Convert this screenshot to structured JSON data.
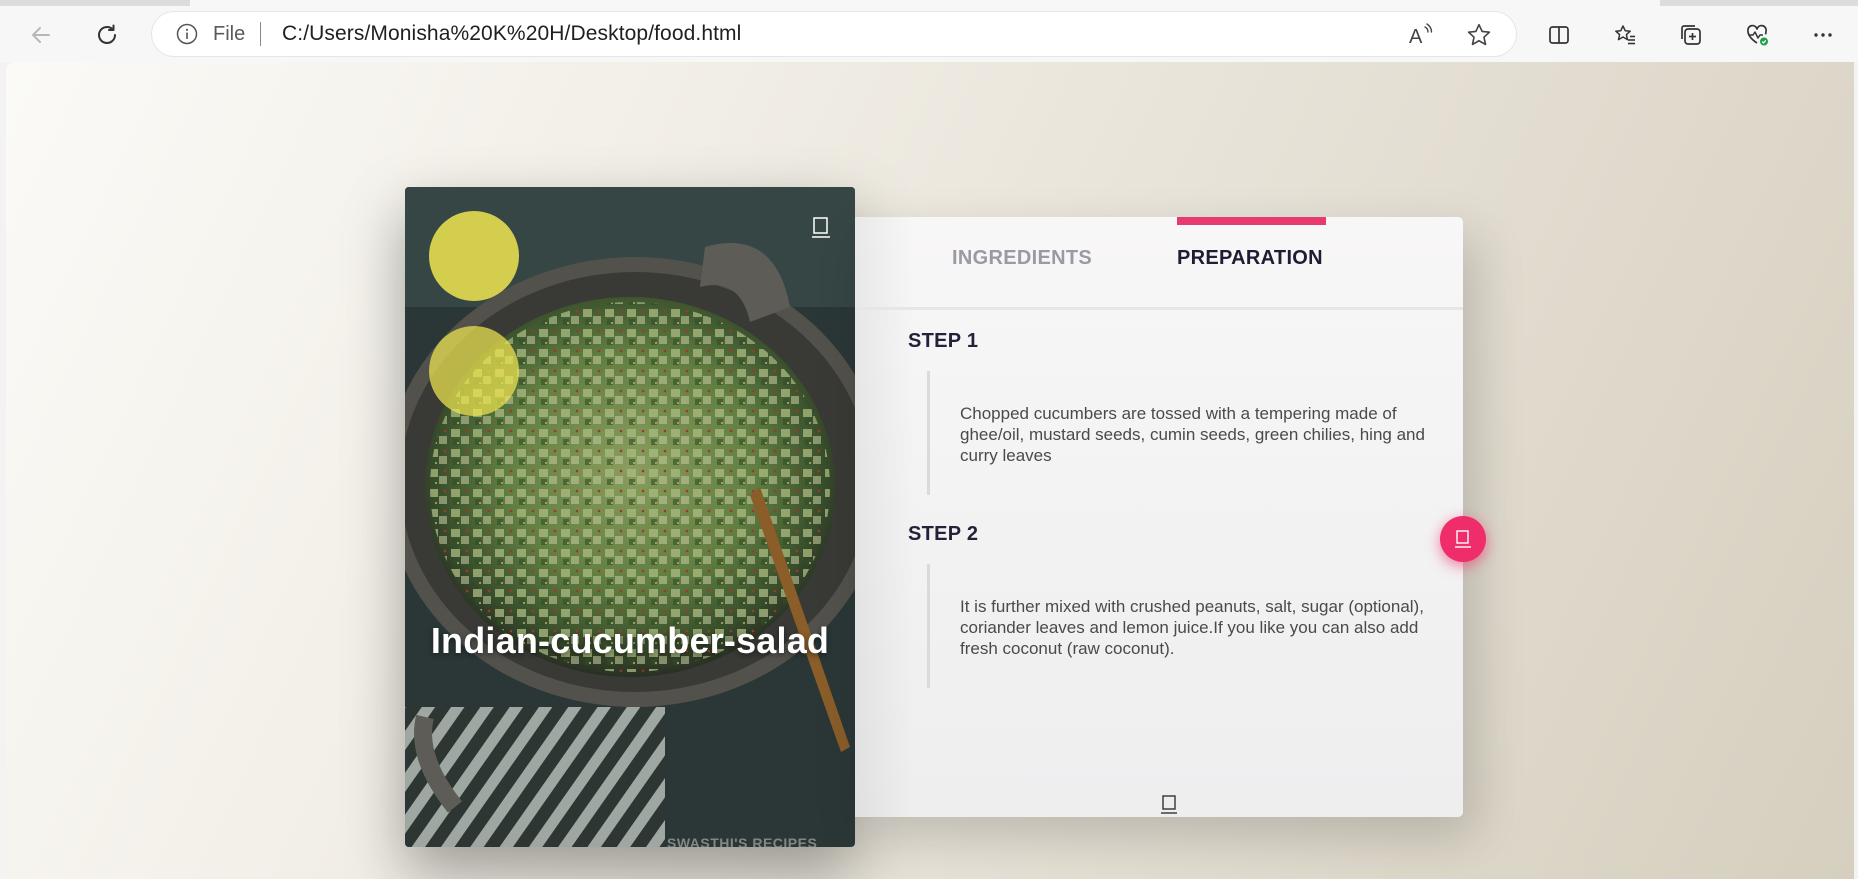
{
  "browser": {
    "address": {
      "scheme_label": "File",
      "url": "C:/Users/Monisha%20K%20H/Desktop/food.html"
    }
  },
  "recipe": {
    "title": "Indian-cucumber-salad",
    "watermark": "SWASTHI'S RECIPES",
    "tabs": [
      {
        "label": "INGREDIENTS",
        "active": false
      },
      {
        "label": "PREPARATION",
        "active": true
      }
    ],
    "steps": [
      {
        "title": "STEP 1",
        "text": "Chopped cucumbers are tossed with a tempering made of ghee/oil, mustard seeds, cumin seeds, green chilies, hing and curry leaves"
      },
      {
        "title": "STEP 2",
        "text": "It is further mixed with crushed peanuts, salt, sugar (optional), coriander leaves and lemon juice.If you like you can also add fresh coconut (raw coconut)."
      }
    ]
  },
  "colors": {
    "accent": "#ee2d6a",
    "tab_active": "#1e1d33",
    "tab_inactive": "#9a99a4",
    "circle": "#eee650"
  },
  "icons": {
    "back": "back-arrow-icon",
    "refresh": "refresh-icon",
    "info": "info-icon",
    "read_aloud": "read-aloud-icon",
    "favorite": "star-icon",
    "split": "split-screen-icon",
    "favorites": "favorites-list-icon",
    "collections": "collections-icon",
    "health": "browser-essentials-icon",
    "more": "more-icon"
  }
}
